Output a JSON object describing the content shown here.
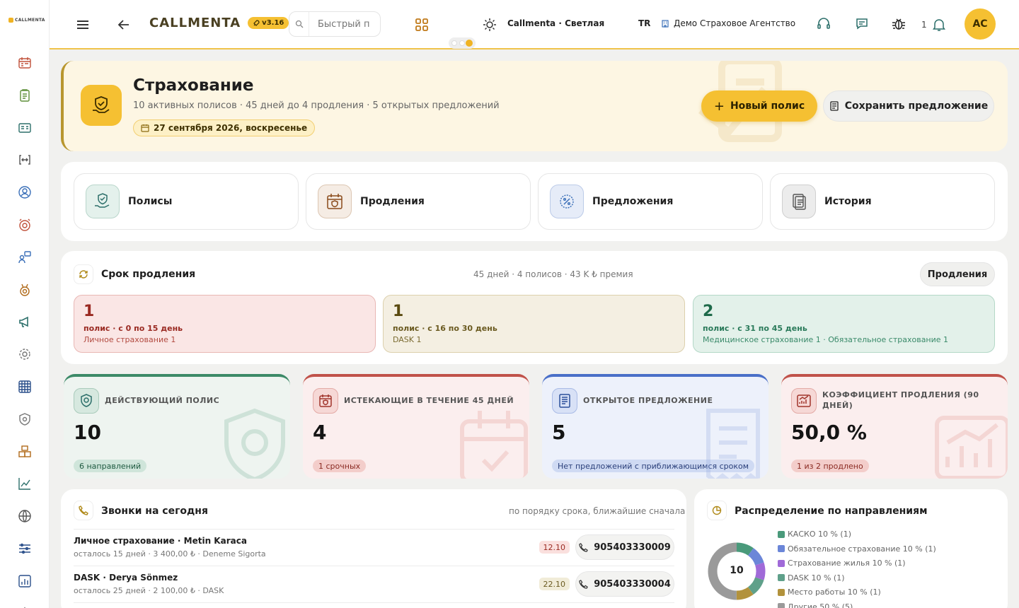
{
  "sidebar": {
    "logo_text": "CALLMENTA",
    "items": [
      {
        "icon": "calendar-icon"
      },
      {
        "icon": "clipboard-icon"
      },
      {
        "icon": "id-card-icon"
      },
      {
        "icon": "code-brackets-icon"
      },
      {
        "icon": "user-circle-icon"
      },
      {
        "icon": "alarm-icon"
      },
      {
        "icon": "chat-user-icon"
      },
      {
        "icon": "medal-icon"
      },
      {
        "icon": "megaphone-icon"
      },
      {
        "icon": "gear-icon"
      },
      {
        "icon": "grid-icon"
      },
      {
        "icon": "shield-icon"
      },
      {
        "icon": "boxes-icon"
      },
      {
        "icon": "line-chart-icon"
      },
      {
        "icon": "globe-icon"
      },
      {
        "icon": "sliders-icon"
      },
      {
        "icon": "bar-chart-icon"
      },
      {
        "icon": "warning-icon"
      }
    ]
  },
  "topbar": {
    "brand": "CALLMENTA",
    "version": "v3.16",
    "search_placeholder": "Быстрый п",
    "theme_label": "Callmenta · Светлая",
    "lang": "TR",
    "agency": "Демо Страховое Агентство",
    "notif_count": "1",
    "avatar": "AC"
  },
  "hero": {
    "title": "Страхование",
    "subtitle": "10 активных полисов · 45 дней до 4 продления · 5 открытых предложений",
    "date": "27 сентября 2026, воскресенье",
    "new_policy": "Новый полис",
    "save_offer": "Сохранить предложение"
  },
  "quick": [
    {
      "label": "Полисы"
    },
    {
      "label": "Продления"
    },
    {
      "label": "Предложения"
    },
    {
      "label": "История"
    }
  ],
  "renewal": {
    "title": "Срок продления",
    "summary": "45 дней · 4 полисов · 43 K ₺ премия",
    "button": "Продления",
    "buckets": [
      {
        "count": "1",
        "range": "полис · с 0 по 15 день",
        "types": "Личное страхование 1"
      },
      {
        "count": "1",
        "range": "полис · с 16 по 30 день",
        "types": "DASK 1"
      },
      {
        "count": "2",
        "range": "полис · с 31 по 45 день",
        "types": "Медицинское страхование 1 · Обязательное страхование 1"
      }
    ]
  },
  "kpis": [
    {
      "label": "ДЕЙСТВУЮЩИЙ ПОЛИС",
      "value": "10",
      "badge": "6 направлений"
    },
    {
      "label": "ИСТЕКАЮЩИЕ В ТЕЧЕНИЕ 45 ДНЕЙ",
      "value": "4",
      "badge": "1 срочных"
    },
    {
      "label": "ОТКРЫТОЕ ПРЕДЛОЖЕНИЕ",
      "value": "5",
      "badge": "Нет предложений с приближающимся сроком"
    },
    {
      "label": "КОЭФФИЦИЕНТ ПРОДЛЕНИЯ (90 ДНЕЙ)",
      "value": "50,0 %",
      "badge": "1 из 2 продлено"
    }
  ],
  "calls": {
    "title": "Звонки на сегодня",
    "sort": "по порядку срока, ближайшие сначала",
    "rows": [
      {
        "title": "Личное страхование · Metin Karaca",
        "sub": "осталось 15 дней · 3 400,00 ₺ · Deneme Sigorta",
        "date": "12.10",
        "phone": "905403330009"
      },
      {
        "title": "DASK · Derya Sönmez",
        "sub": "осталось 25 дней · 2 100,00 ₺ · DASK",
        "date": "22.10",
        "phone": "905403330004"
      }
    ]
  },
  "distribution": {
    "title": "Распределение по направлениям",
    "total": "10",
    "legend": [
      {
        "label": "КАСКО 10 % (1)",
        "value": 10,
        "color": "#4a9a7b"
      },
      {
        "label": "Обязательное страхование 10 % (1)",
        "value": 10,
        "color": "#6b86d8"
      },
      {
        "label": "Страхование жилья 10 % (1)",
        "value": 10,
        "color": "#a06ad8"
      },
      {
        "label": "DASK 10 % (1)",
        "value": 10,
        "color": "#5fa08a"
      },
      {
        "label": "Место работы 10 % (1)",
        "value": 10,
        "color": "#b2923c"
      },
      {
        "label": "Другие 50 % (5)",
        "value": 50,
        "color": "#9a9a9a"
      }
    ]
  }
}
